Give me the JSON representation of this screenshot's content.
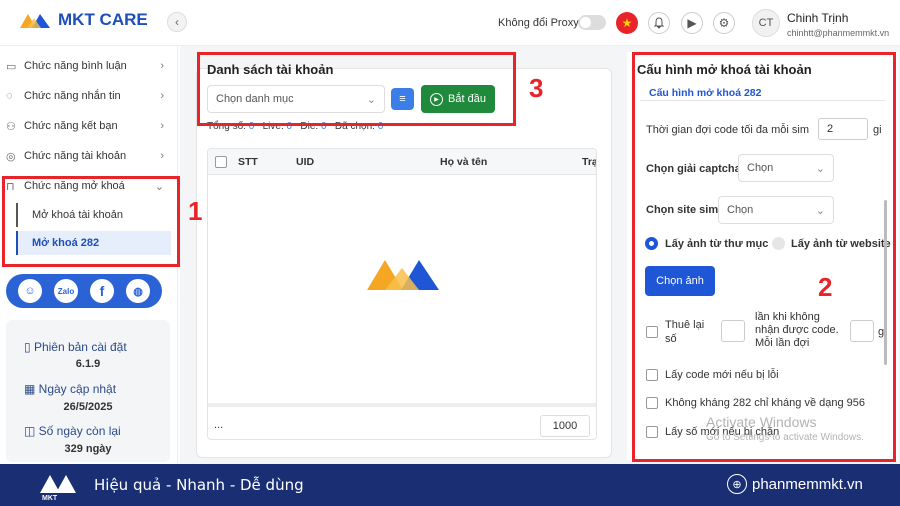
{
  "app": {
    "logo_text": "MKT CARE"
  },
  "header": {
    "proxy_label": "Không đổi Proxy",
    "avatar_initials": "CT",
    "user_name": "Chinh Trịnh",
    "user_email": "chinhtt@phanmemmkt.vn"
  },
  "sidebar": {
    "items": [
      {
        "label": "Chức năng bình luận",
        "icon": "comment-icon"
      },
      {
        "label": "Chức năng nhắn tin",
        "icon": "chat-icon"
      },
      {
        "label": "Chức năng kết bạn",
        "icon": "add-user-icon"
      },
      {
        "label": "Chức năng tài khoản",
        "icon": "account-icon"
      },
      {
        "label": "Chức năng mở khoá",
        "icon": "lock-icon"
      }
    ],
    "sub_items": [
      {
        "label": "Mở khoá tài khoản"
      },
      {
        "label": "Mở khoá 282"
      }
    ],
    "info": {
      "version_label": "Phiên bản cài đặt",
      "version_value": "6.1.9",
      "update_label": "Ngày cập nhật",
      "update_value": "26/5/2025",
      "days_label": "Số ngày còn lại",
      "days_value": "329 ngày"
    }
  },
  "accounts": {
    "title": "Danh sách tài khoản",
    "select_placeholder": "Chọn danh mục",
    "start_button": "Bắt đầu",
    "stats": {
      "total_label": "Tổng số:",
      "total": "0",
      "live_label": "Live:",
      "live": "0",
      "die_label": "Die:",
      "die": "0",
      "selected_label": "Đã chọn:",
      "selected": "0"
    },
    "columns": [
      "STT",
      "UID",
      "Họ và tên",
      "Trạ"
    ],
    "footer_dots": "...",
    "page_size": "1000"
  },
  "config": {
    "title": "Cấu hình mở khoá tài khoản",
    "tab": "Cấu hình mở khoá 282",
    "wait_label": "Thời gian đợi code tối đa mỗi sim",
    "wait_value": "2",
    "wait_unit": "gi",
    "captcha_label": "Chọn giải captcha",
    "captcha_value": "Chọn",
    "site_label": "Chọn site sim",
    "site_value": "Chọn",
    "radio_folder": "Lấy ảnh từ thư mục",
    "radio_website": "Lấy ảnh từ website",
    "choose_image": "Chọn ảnh",
    "retry_prefix_1": "Thuê lại",
    "retry_prefix_2": "số",
    "retry_mid": "lần khi không nhận được code. Mỗi lần đợi",
    "retry_suffix": "g",
    "opt1": "Lấy code mới nếu bị lỗi",
    "opt2": "Không kháng 282 chỉ kháng về dạng 956",
    "opt3": "Lấy số mới nếu bị chặn"
  },
  "watermark": {
    "line1": "Activate Windows",
    "line2": "Go to Settings to activate Windows."
  },
  "annotations": {
    "n1": "1",
    "n2": "2",
    "n3": "3"
  },
  "footer": {
    "slogan": "Hiệu quả - Nhanh - Dễ dùng",
    "site": "phanmemmkt.vn"
  },
  "colors": {
    "brand_blue": "#1e4fb8",
    "start_green": "#1f8a3b",
    "highlight_red": "#e8232a",
    "footer_navy": "#1a2e73"
  }
}
